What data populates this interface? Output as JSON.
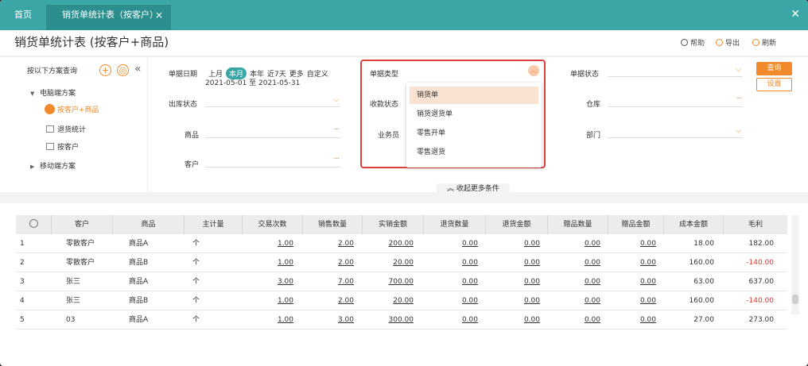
{
  "tabs": {
    "home": "首页",
    "active": "销货单统计表（按客户）",
    "close": "×"
  },
  "window_close": "✕",
  "title": "销货单统计表 (按客户+商品)",
  "toolbar": {
    "help": "帮助",
    "export": "导出",
    "refresh": "刷新"
  },
  "scheme": {
    "head": "按以下方案查询",
    "add": "+",
    "collapse": "«",
    "groups": [
      {
        "label": "电脑端方案"
      },
      {
        "label": "移动端方案"
      }
    ],
    "items": [
      {
        "label": "按客户+商品"
      },
      {
        "label": "退货统计"
      },
      {
        "label": "按客户"
      }
    ]
  },
  "filters": {
    "date_label": "单据日期",
    "date_options": [
      "上月",
      "本月",
      "本年",
      "近7天",
      "更多",
      "自定义"
    ],
    "date_range": "2021-05-01 至 2021-05-31",
    "out_status": "出库状态",
    "product": "商品",
    "customer": "客户",
    "doc_type": "单据类型",
    "pay_status": "收款状态",
    "salesman": "业务员",
    "doc_status": "单据状态",
    "warehouse": "仓库",
    "department": "部门"
  },
  "dropdown": [
    "销货单",
    "销货退货单",
    "零售开单",
    "零售退货"
  ],
  "buttons": {
    "query": "查询",
    "settings": "设置",
    "more": "收起更多条件"
  },
  "table": {
    "headers": [
      "客户",
      "商品",
      "主计量",
      "交易次数",
      "销售数量",
      "实销金额",
      "退货数量",
      "退货金额",
      "赠品数量",
      "赠品金额",
      "成本金额",
      "毛利"
    ],
    "rows": [
      [
        "1",
        "零散客户",
        "商品A",
        "个",
        "1.00",
        "2.00",
        "200.00",
        "0.00",
        "0.00",
        "0.00",
        "0.00",
        "18.00",
        "182.00"
      ],
      [
        "2",
        "零散客户",
        "商品B",
        "个",
        "1.00",
        "2.00",
        "20.00",
        "0.00",
        "0.00",
        "0.00",
        "0.00",
        "160.00",
        "-140.00"
      ],
      [
        "3",
        "张三",
        "商品A",
        "个",
        "3.00",
        "7.00",
        "700.00",
        "0.00",
        "0.00",
        "0.00",
        "0.00",
        "63.00",
        "637.00"
      ],
      [
        "4",
        "张三",
        "商品B",
        "个",
        "1.00",
        "2.00",
        "20.00",
        "0.00",
        "0.00",
        "0.00",
        "0.00",
        "160.00",
        "-140.00"
      ],
      [
        "5",
        "03",
        "商品A",
        "个",
        "1.00",
        "3.00",
        "300.00",
        "0.00",
        "0.00",
        "0.00",
        "0.00",
        "27.00",
        "273.00"
      ]
    ]
  },
  "colors": {
    "accent": "#3aa7a6",
    "orange": "#f08a2b",
    "negative": "#d9403c"
  }
}
